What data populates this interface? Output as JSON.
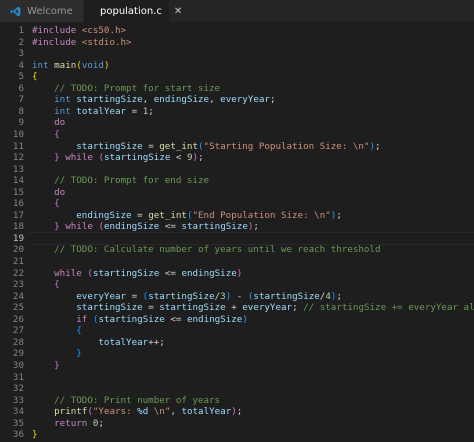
{
  "tabs": [
    {
      "label": "Welcome",
      "icon": "vscode-icon",
      "active": false
    },
    {
      "label": "population.c",
      "icon": "c-file-icon",
      "active": true,
      "close": "✕"
    }
  ],
  "colors": {
    "accent": "#007acc",
    "background": "#1e1e1e"
  },
  "editor": {
    "current_line": 19,
    "lines": [
      {
        "n": "1",
        "t": [
          [
            "pp",
            "#include "
          ],
          [
            "str",
            "<cs50.h>"
          ]
        ]
      },
      {
        "n": "2",
        "t": [
          [
            "pp",
            "#include "
          ],
          [
            "str",
            "<stdio.h>"
          ]
        ]
      },
      {
        "n": "3",
        "t": []
      },
      {
        "n": "4",
        "t": [
          [
            "ty",
            "int "
          ],
          [
            "fn",
            "main"
          ],
          [
            "br1",
            "("
          ],
          [
            "ty",
            "void"
          ],
          [
            "br1",
            ")"
          ]
        ]
      },
      {
        "n": "5",
        "t": [
          [
            "br1",
            "{"
          ]
        ]
      },
      {
        "n": "6",
        "t": [
          [
            "",
            "    "
          ],
          [
            "cm",
            "// TODO: Prompt for start size"
          ]
        ]
      },
      {
        "n": "7",
        "t": [
          [
            "",
            "    "
          ],
          [
            "ty",
            "int "
          ],
          [
            "var",
            "startingSize"
          ],
          [
            "",
            ", "
          ],
          [
            "var",
            "endingSize"
          ],
          [
            "",
            ", "
          ],
          [
            "var",
            "everyYear"
          ],
          [
            "",
            ";"
          ]
        ]
      },
      {
        "n": "8",
        "t": [
          [
            "",
            "    "
          ],
          [
            "ty",
            "int "
          ],
          [
            "var",
            "totalYear"
          ],
          [
            "",
            " = "
          ],
          [
            "num",
            "1"
          ],
          [
            "",
            ";"
          ]
        ]
      },
      {
        "n": "9",
        "t": [
          [
            "",
            "    "
          ],
          [
            "cl",
            "do"
          ]
        ]
      },
      {
        "n": "10",
        "t": [
          [
            "",
            "    "
          ],
          [
            "br2",
            "{"
          ]
        ]
      },
      {
        "n": "11",
        "t": [
          [
            "",
            "        "
          ],
          [
            "var",
            "startingSize"
          ],
          [
            "",
            " = "
          ],
          [
            "fn",
            "get_int"
          ],
          [
            "br3",
            "("
          ],
          [
            "str",
            "\"Starting Population Size: \\n\""
          ],
          [
            "br3",
            ")"
          ],
          [
            "",
            ";"
          ]
        ]
      },
      {
        "n": "12",
        "t": [
          [
            "",
            "    "
          ],
          [
            "br2",
            "}"
          ],
          [
            "",
            " "
          ],
          [
            "cl",
            "while"
          ],
          [
            "",
            " "
          ],
          [
            "br2",
            "("
          ],
          [
            "var",
            "startingSize"
          ],
          [
            "",
            " < "
          ],
          [
            "num",
            "9"
          ],
          [
            "br2",
            ")"
          ],
          [
            "",
            ";"
          ]
        ]
      },
      {
        "n": "13",
        "t": []
      },
      {
        "n": "14",
        "t": [
          [
            "",
            "    "
          ],
          [
            "cm",
            "// TODO: Prompt for end size"
          ]
        ]
      },
      {
        "n": "15",
        "t": [
          [
            "",
            "    "
          ],
          [
            "cl",
            "do"
          ]
        ]
      },
      {
        "n": "16",
        "t": [
          [
            "",
            "    "
          ],
          [
            "br2",
            "{"
          ]
        ]
      },
      {
        "n": "17",
        "t": [
          [
            "",
            "        "
          ],
          [
            "var",
            "endingSize"
          ],
          [
            "",
            " = "
          ],
          [
            "fn",
            "get_int"
          ],
          [
            "br3",
            "("
          ],
          [
            "str",
            "\"End Population Size: \\n\""
          ],
          [
            "br3",
            ")"
          ],
          [
            "",
            ";"
          ]
        ]
      },
      {
        "n": "18",
        "t": [
          [
            "",
            "    "
          ],
          [
            "br2",
            "}"
          ],
          [
            "",
            " "
          ],
          [
            "cl",
            "while"
          ],
          [
            "",
            " "
          ],
          [
            "br2",
            "("
          ],
          [
            "var",
            "endingSize"
          ],
          [
            "",
            " <= "
          ],
          [
            "var",
            "startingSize"
          ],
          [
            "br2",
            ")"
          ],
          [
            "",
            ";"
          ]
        ]
      },
      {
        "n": "19",
        "t": []
      },
      {
        "n": "20",
        "t": [
          [
            "",
            "    "
          ],
          [
            "cm",
            "// TODO: Calculate number of years until we reach threshold"
          ]
        ]
      },
      {
        "n": "21",
        "t": []
      },
      {
        "n": "22",
        "t": [
          [
            "",
            "    "
          ],
          [
            "cl",
            "while"
          ],
          [
            "",
            " "
          ],
          [
            "br2",
            "("
          ],
          [
            "var",
            "startingSize"
          ],
          [
            "",
            " <= "
          ],
          [
            "var",
            "endingSize"
          ],
          [
            "br2",
            ")"
          ]
        ]
      },
      {
        "n": "23",
        "t": [
          [
            "",
            "    "
          ],
          [
            "br2",
            "{"
          ]
        ]
      },
      {
        "n": "24",
        "t": [
          [
            "",
            "        "
          ],
          [
            "var",
            "everyYear"
          ],
          [
            "",
            " = "
          ],
          [
            "br3",
            "("
          ],
          [
            "var",
            "startingSize"
          ],
          [
            "",
            "/"
          ],
          [
            "num",
            "3"
          ],
          [
            "br3",
            ")"
          ],
          [
            "",
            " - "
          ],
          [
            "br3",
            "("
          ],
          [
            "var",
            "startingSize"
          ],
          [
            "",
            "/"
          ],
          [
            "num",
            "4"
          ],
          [
            "br3",
            ")"
          ],
          [
            "",
            ";"
          ]
        ]
      },
      {
        "n": "25",
        "t": [
          [
            "",
            "        "
          ],
          [
            "var",
            "startingSize"
          ],
          [
            "",
            " = "
          ],
          [
            "var",
            "startingSize"
          ],
          [
            "",
            " + "
          ],
          [
            "var",
            "everyYear"
          ],
          [
            "",
            "; "
          ],
          [
            "cm",
            "// startingSize += everyYear also I can"
          ]
        ]
      },
      {
        "n": "26",
        "t": [
          [
            "",
            "        "
          ],
          [
            "cl",
            "if"
          ],
          [
            "",
            " "
          ],
          [
            "br3",
            "("
          ],
          [
            "var",
            "startingSize"
          ],
          [
            "",
            " <= "
          ],
          [
            "var",
            "endingSize"
          ],
          [
            "br3",
            ")"
          ]
        ]
      },
      {
        "n": "27",
        "t": [
          [
            "",
            "        "
          ],
          [
            "br3",
            "{"
          ]
        ]
      },
      {
        "n": "28",
        "t": [
          [
            "",
            "            "
          ],
          [
            "var",
            "totalYear"
          ],
          [
            "",
            "++;"
          ]
        ]
      },
      {
        "n": "29",
        "t": [
          [
            "",
            "        "
          ],
          [
            "br3",
            "}"
          ]
        ]
      },
      {
        "n": "30",
        "t": [
          [
            "",
            "    "
          ],
          [
            "br2",
            "}"
          ]
        ]
      },
      {
        "n": "31",
        "t": []
      },
      {
        "n": "32",
        "t": []
      },
      {
        "n": "33",
        "t": [
          [
            "",
            "    "
          ],
          [
            "cm",
            "// TODO: Print number of years"
          ]
        ]
      },
      {
        "n": "34",
        "t": [
          [
            "",
            "    "
          ],
          [
            "fn",
            "printf"
          ],
          [
            "br2",
            "("
          ],
          [
            "str",
            "\"Years: "
          ],
          [
            "var",
            "%d"
          ],
          [
            "str",
            " \\n\""
          ],
          [
            "",
            ", "
          ],
          [
            "var",
            "totalYear"
          ],
          [
            "br2",
            ")"
          ],
          [
            "",
            ";"
          ]
        ]
      },
      {
        "n": "35",
        "t": [
          [
            "",
            "    "
          ],
          [
            "cl",
            "return"
          ],
          [
            "",
            " "
          ],
          [
            "num",
            "0"
          ],
          [
            "",
            ";"
          ]
        ]
      },
      {
        "n": "36",
        "t": [
          [
            "br1",
            "}"
          ]
        ]
      }
    ]
  }
}
